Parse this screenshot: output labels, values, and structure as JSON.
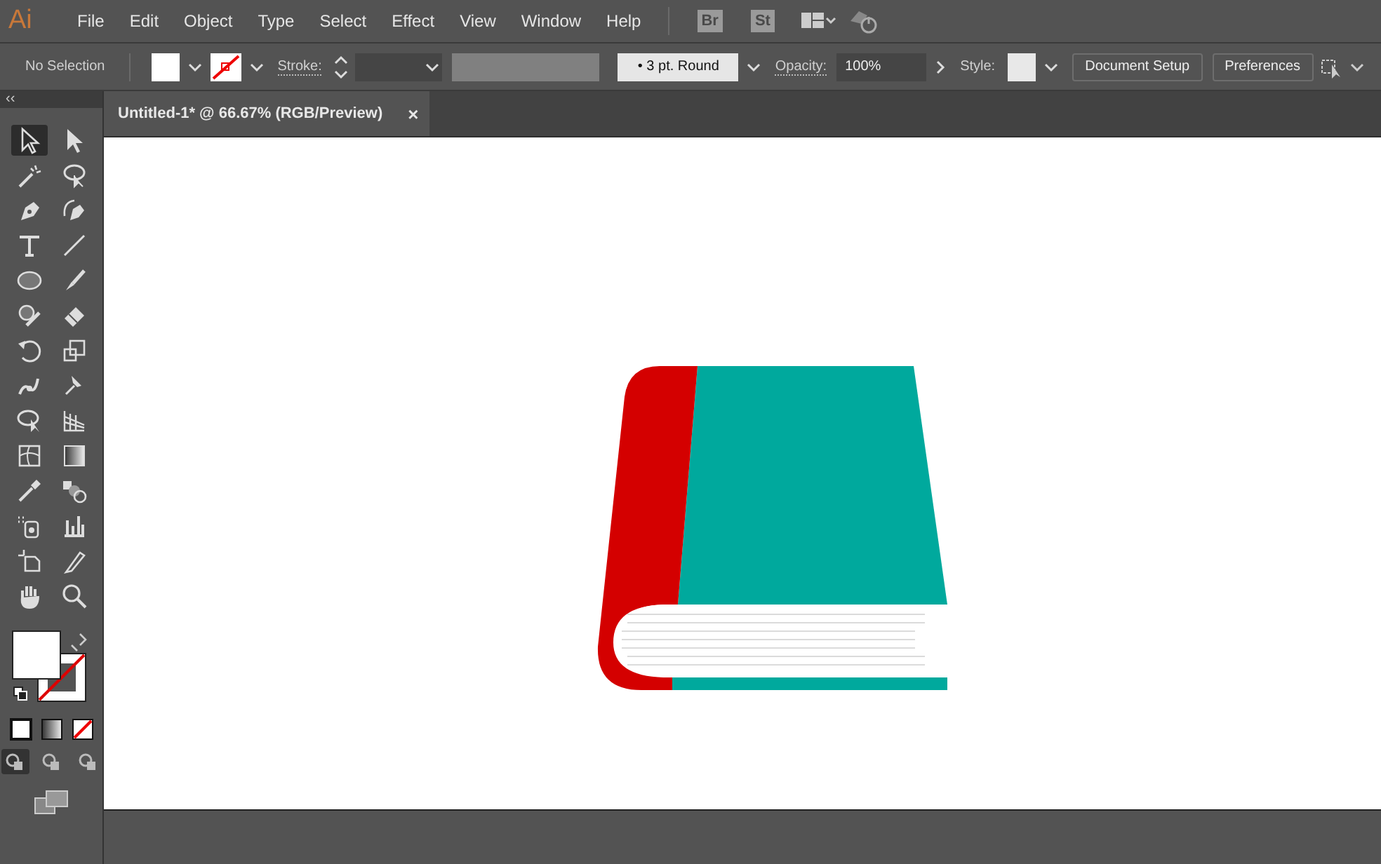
{
  "app": {
    "logo": "Ai",
    "menu": [
      "File",
      "Edit",
      "Object",
      "Type",
      "Select",
      "Effect",
      "View",
      "Window",
      "Help"
    ],
    "badges": [
      "Br",
      "St"
    ]
  },
  "control_bar": {
    "selection": "No Selection",
    "stroke_label": "Stroke:",
    "brush": "• 3 pt. Round",
    "opacity_label": "Opacity:",
    "opacity": "100%",
    "style_label": "Style:",
    "buttons": [
      "Document Setup",
      "Preferences"
    ]
  },
  "panel_toggle": "‹‹",
  "document_tab": {
    "title": "Untitled-1* @ 66.67% (RGB/Preview)",
    "close": "×"
  },
  "tools": [
    {
      "selected": true
    },
    {
      "selected": false
    },
    {
      "selected": false
    },
    {
      "selected": false
    },
    {
      "selected": false
    },
    {
      "selected": false
    },
    {
      "selected": false
    },
    {
      "selected": false
    },
    {
      "selected": false
    },
    {
      "selected": false
    },
    {
      "selected": false
    },
    {
      "selected": false
    },
    {
      "selected": false
    },
    {
      "selected": false
    },
    {
      "selected": false
    },
    {
      "selected": false
    },
    {
      "selected": false
    },
    {
      "selected": false
    },
    {
      "selected": false
    },
    {
      "selected": false
    },
    {
      "selected": false
    },
    {
      "selected": false
    },
    {
      "selected": false
    },
    {
      "selected": false
    },
    {
      "selected": false
    },
    {
      "selected": false
    },
    {
      "selected": false
    },
    {
      "selected": false
    }
  ],
  "draw_modes": [
    {
      "selected": true
    },
    {
      "selected": false
    },
    {
      "selected": false
    }
  ]
}
